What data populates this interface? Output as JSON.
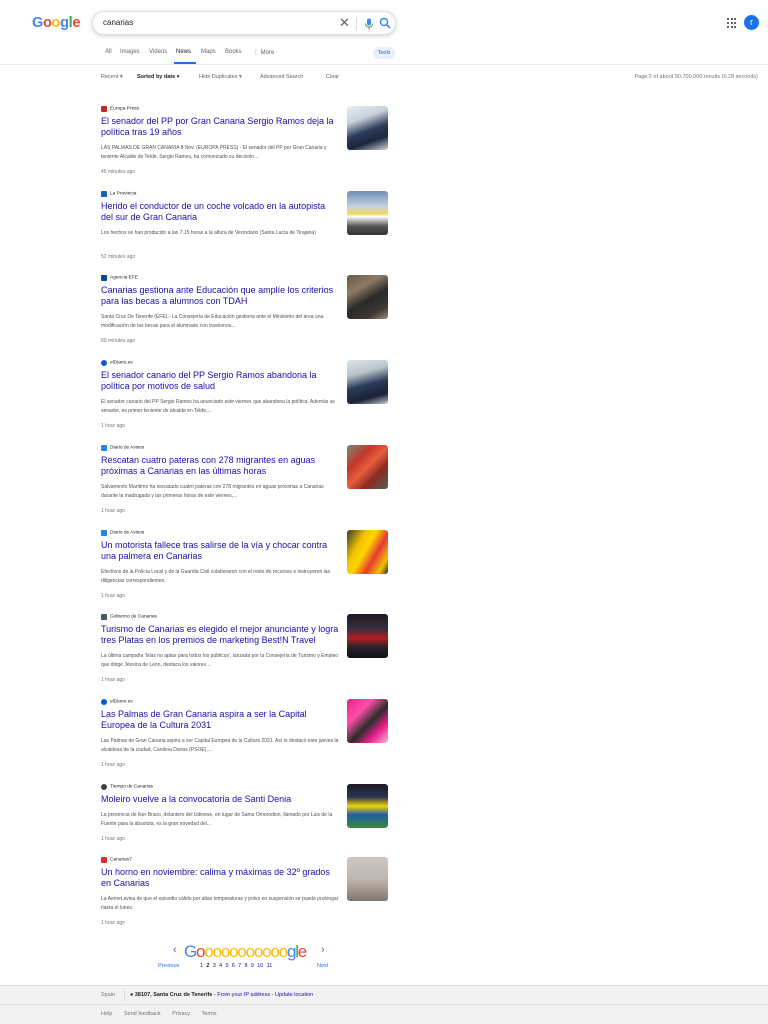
{
  "search": {
    "query": "canarias"
  },
  "logo": [
    "G",
    "o",
    "o",
    "g",
    "l",
    "e"
  ],
  "tabs": [
    "All",
    "Images",
    "Videos",
    "News",
    "Maps",
    "Books",
    "⋮ More"
  ],
  "tools_label": "Tools",
  "toolbar": {
    "recent": "Recent ▾",
    "sorted": "Sorted by date ▾",
    "hide": "Hide Duplicates ▾",
    "advanced": "Advanced Search",
    "clear": "Clear"
  },
  "stats": "Page 2 of about 50,700,000 results (0.28 seconds)",
  "user_initial": "r",
  "results": [
    {
      "source": "Europa Press",
      "title": "El senador del PP por Gran Canaria Sergio Ramos deja la política tras 19 años",
      "snippet": "LAS PALMAS DE GRAN CANARIA 8 Nov. (EUROPA PRESS) - El senador del PP por Gran Canaria y teniente Alcalde de Telde, Sergio Ramos, ha comunicado su decisión...",
      "time": "45 minutes ago",
      "fav_color": "#c62828"
    },
    {
      "source": "La Provincia",
      "title": "Herido el conductor de un coche volcado en la autopista del sur de Gran Canaria",
      "snippet": "Los hechos se han producido a las 7.15 horas a la altura de Vecindario (Santa Lucía de Tirajana)",
      "time": "52 minutes ago",
      "fav_color": "#1565c0"
    },
    {
      "source": "Agencia EFE",
      "title": "Canarias gestiona ante Educación que amplíe los criterios para las becas a alumnos con TDAH",
      "snippet": "Santa Cruz De Tenerife (EFE).- La Consejería de Educación gestiona ante el Ministerio del área una modificación de las becas para el alumnado con trastornos...",
      "time": "60 minutes ago",
      "fav_color": "#0d47a1"
    },
    {
      "source": "elDiario.es",
      "title": "El senador canario del PP Sergio Ramos abandona la política por motivos de salud",
      "snippet": "El senador canario del PP Sergio Ramos ha anunciado este viernes que abandona la política. Además se senador, es primer teniente de alcalde en Telde,...",
      "time": "1 hour ago",
      "fav_color": "#0b57d0"
    },
    {
      "source": "Diario de Avisos",
      "title": "Rescatan cuatro pateras con 278 migrantes en aguas próximas a Canarias en las últimas horas",
      "snippet": "Salvamento Marítimo ha rescatado cuatro pateras con 278 migrantes en aguas próximas a Canarias durante la madrugada y las primeras horas de este viernes,...",
      "time": "1 hour ago",
      "fav_color": "#1e88e5"
    },
    {
      "source": "Diario de Avisos",
      "title": "Un motorista fallece tras salirse de la vía y chocar contra una palmera en Canarias",
      "snippet": "Efectivos de la Policía Local y de la Guardia Civil colaboraron con el resto de recursos e instruyeron las diligencias correspondientes.",
      "time": "1 hour ago",
      "fav_color": "#1e88e5"
    },
    {
      "source": "Gobierno de Canarias",
      "title": "Turismo de Canarias es elegido el mejor anunciante y logra tres Platas en los premios de marketing Best!N Travel",
      "snippet": "La última campaña 'Islas no aptas para todos los públicos', lanzada por la Consejería de Turismo y Empleo que dirige Jéssica de León, destaca los valores...",
      "time": "1 hour ago",
      "fav_color": "#455a64"
    },
    {
      "source": "elDiario.es",
      "title": "Las Palmas de Gran Canaria aspira a ser la Capital Europea de la Cultura 2031",
      "snippet": "Las Palmas de Gran Canaria aspira a ser Capital Europea de la Cultura 2031. Así lo destacó este jueves la alcaldesa de la ciudad, Carolina Darias (PSOE),...",
      "time": "1 hour ago",
      "fav_color": "#0b57d0"
    },
    {
      "source": "Tiempo de Canarias",
      "title": "Moleiro vuelve a la convocatoria de Santi Denia",
      "snippet": "La presencia de Iker Bravo, delantero del Udinese, en lugar de Samu Omorodion, llamado por Luis de la Fuente para la absoluta, es la gran novedad del...",
      "time": "1 hour ago",
      "fav_color": "#424242"
    },
    {
      "source": "Canarias7",
      "title": "Un horno en noviembre: calima y máximas de 32º grados en Canarias",
      "snippet": "La Aemet avisa de que el episodio cálido por altas temperaturas y polvo en suspensión se puede prolongar hasta el lunes.",
      "time": "1 hour ago",
      "fav_color": "#d32f2f"
    }
  ],
  "pagination": {
    "logo": [
      {
        "c": "G",
        "col": "#4285f4"
      },
      {
        "c": "o",
        "col": "#ea4335"
      },
      {
        "c": "o",
        "col": "#fbbc05"
      },
      {
        "c": "o",
        "col": "#fbbc05"
      },
      {
        "c": "o",
        "col": "#fbbc05"
      },
      {
        "c": "o",
        "col": "#fbbc05"
      },
      {
        "c": "o",
        "col": "#fbbc05"
      },
      {
        "c": "o",
        "col": "#fbbc05"
      },
      {
        "c": "o",
        "col": "#fbbc05"
      },
      {
        "c": "o",
        "col": "#fbbc05"
      },
      {
        "c": "o",
        "col": "#fbbc05"
      },
      {
        "c": "o",
        "col": "#fbbc05"
      },
      {
        "c": "g",
        "col": "#4285f4"
      },
      {
        "c": "l",
        "col": "#34a853"
      },
      {
        "c": "e",
        "col": "#ea4335"
      }
    ],
    "prev": "Previous",
    "next": "Next",
    "pages": [
      "1",
      "2",
      "3",
      "4",
      "5",
      "6",
      "7",
      "8",
      "9",
      "10",
      "11"
    ],
    "current": "2"
  },
  "footer": {
    "country": "Spain",
    "location": "38107, Santa Cruz de Tenerife",
    "from_ip": "From your IP address",
    "update": "Update location",
    "links": [
      "Help",
      "Send feedback",
      "Privacy",
      "Terms"
    ]
  }
}
